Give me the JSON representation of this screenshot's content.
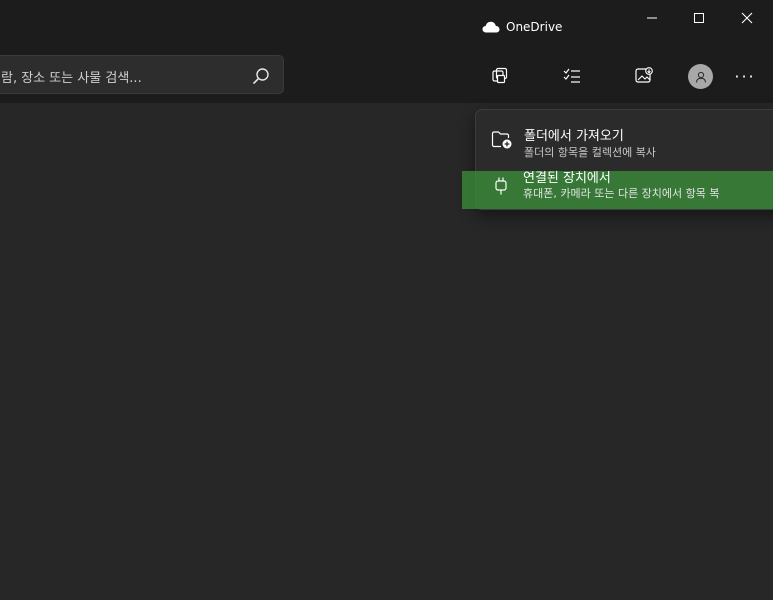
{
  "titlebar": {
    "onedrive_label": "OneDrive",
    "minimize_icon": "minimize-icon",
    "maximize_icon": "maximize-icon",
    "close_icon": "close-icon"
  },
  "toolbar": {
    "search_placeholder": "람, 장소 또는 사물 검색...",
    "buttons": [
      "collection-icon",
      "select-list-icon",
      "import-photo-icon",
      "avatar",
      "more-icon"
    ],
    "more_label": "···"
  },
  "import_menu": {
    "items": [
      {
        "title": "폴더에서 가져오기",
        "subtitle": "폴더의 항목을 컬렉션에 복사",
        "icon": "folder-add-icon"
      },
      {
        "title": "연결된 장치에서",
        "subtitle": "휴대폰, 카메라 또는 다른 장치에서 항목 복",
        "icon": "usb-device-icon"
      }
    ]
  },
  "colors": {
    "background": "#272727",
    "bar": "#1c1c1c",
    "menu": "#2b2b2b",
    "highlight": "#3c963c"
  }
}
